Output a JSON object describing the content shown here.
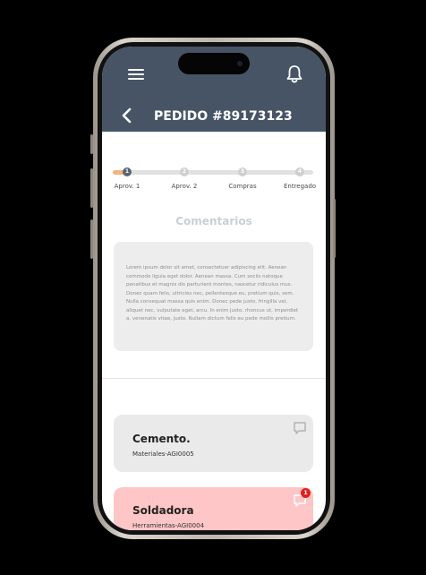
{
  "header": {
    "title": "PEDIDO #89173123",
    "background_color": "#475466",
    "icons": {
      "menu": "menu-icon",
      "notifications": "bell-icon",
      "back": "back-arrow-icon"
    }
  },
  "progress": {
    "fill_fraction": 0.06,
    "fill_color": "#f3b37c",
    "active_color": "#5a6472",
    "steps": [
      {
        "number": "1",
        "label": "Aprov. 1",
        "active": true
      },
      {
        "number": "2",
        "label": "Aprov. 2",
        "active": false
      },
      {
        "number": "3",
        "label": "Compras",
        "active": false
      },
      {
        "number": "4",
        "label": "Entregado",
        "active": false
      }
    ]
  },
  "comments": {
    "title": "Comentarios",
    "text": "Lorem ipsum dolor sit amet, consectetuer adipiscing elit. Aenean commodo ligula eget dolor. Aenean massa. Cum sociis natoque penatibus et magnis dis parturient montes, nascetur ridiculus mus. Donec quam felis, ultricies nec, pellentesque eu, pretium quis, sem. Nulla consequat massa quis enim. Donec pede justo, fringilla vel, aliquet nec, vulputate eget, arcu. In enim justo, rhoncus ut, imperdiet a, venenatis vitae, justo. Nullam dictum felis eu pede mollis pretium."
  },
  "items": [
    {
      "name": "Cemento.",
      "subtitle": "Materiales-AGI0005",
      "color": "#eaeaea",
      "icon": "chat-icon",
      "badge": ""
    },
    {
      "name": "Soldadora",
      "subtitle": "Herramientas-AGI0004",
      "color": "#fec6c6",
      "icon": "chat-icon",
      "badge": "1"
    }
  ]
}
